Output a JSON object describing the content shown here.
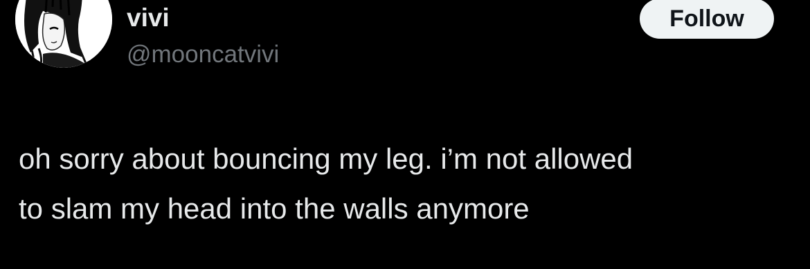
{
  "author": {
    "display_name": "vivi",
    "handle": "@mooncatvivi",
    "avatar_icon": "anime-girl-avatar-icon"
  },
  "follow_button": {
    "label": "Follow"
  },
  "tweet": {
    "lines": [
      "oh sorry about bouncing my leg. i’m not allowed",
      "to slam my head into the walls anymore"
    ]
  },
  "colors": {
    "background": "#000000",
    "primary_text": "#e7e9ea",
    "secondary_text": "#71767b",
    "button_bg": "#eff3f4",
    "button_text": "#0f1419"
  }
}
